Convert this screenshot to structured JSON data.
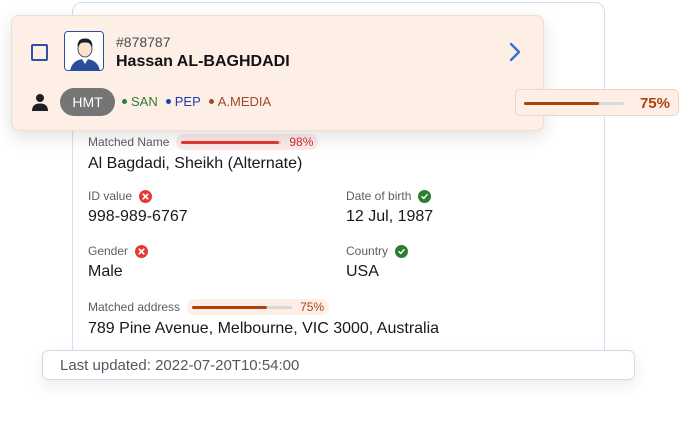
{
  "header": {
    "case_id": "#878787",
    "name": "Hassan AL-BAGHDADI",
    "group_label": "HMT",
    "tags": [
      {
        "label": "SAN",
        "color": "#2e7d32"
      },
      {
        "label": "PEP",
        "color": "#1e40af"
      },
      {
        "label": "A.MEDIA",
        "color": "#a0482a"
      }
    ]
  },
  "overall_score": {
    "label": "75%",
    "value": 0.75,
    "color": "#b2410e"
  },
  "details": {
    "matched_name": {
      "label": "Matched Name",
      "value": "Al Bagdadi, Sheikh (Alternate)",
      "score_label": "98%",
      "score": 0.98,
      "color": "#e53935"
    },
    "id_value": {
      "label": "ID value",
      "value": "998-989-6767",
      "status": "mismatch"
    },
    "date_of_birth": {
      "label": "Date of birth",
      "value": "12 Jul, 1987",
      "status": "match"
    },
    "gender": {
      "label": "Gender",
      "value": "Male",
      "status": "mismatch"
    },
    "country": {
      "label": "Country",
      "value": "USA",
      "status": "match"
    },
    "matched_address": {
      "label": "Matched address",
      "value": "789 Pine Avenue, Melbourne, VIC 3000, Australia",
      "score_label": "75%",
      "score": 0.75,
      "color": "#b2410e"
    }
  },
  "footer": {
    "last_updated": "Last updated: 2022-07-20T10:54:00"
  },
  "colors": {
    "match": "#2e7d32",
    "mismatch": "#e53935",
    "accent_blue": "#3b6fd8"
  },
  "icons": [
    "checkbox-icon",
    "avatar-icon",
    "chevron-right-icon",
    "person-icon",
    "check-circle-icon",
    "x-circle-icon"
  ]
}
